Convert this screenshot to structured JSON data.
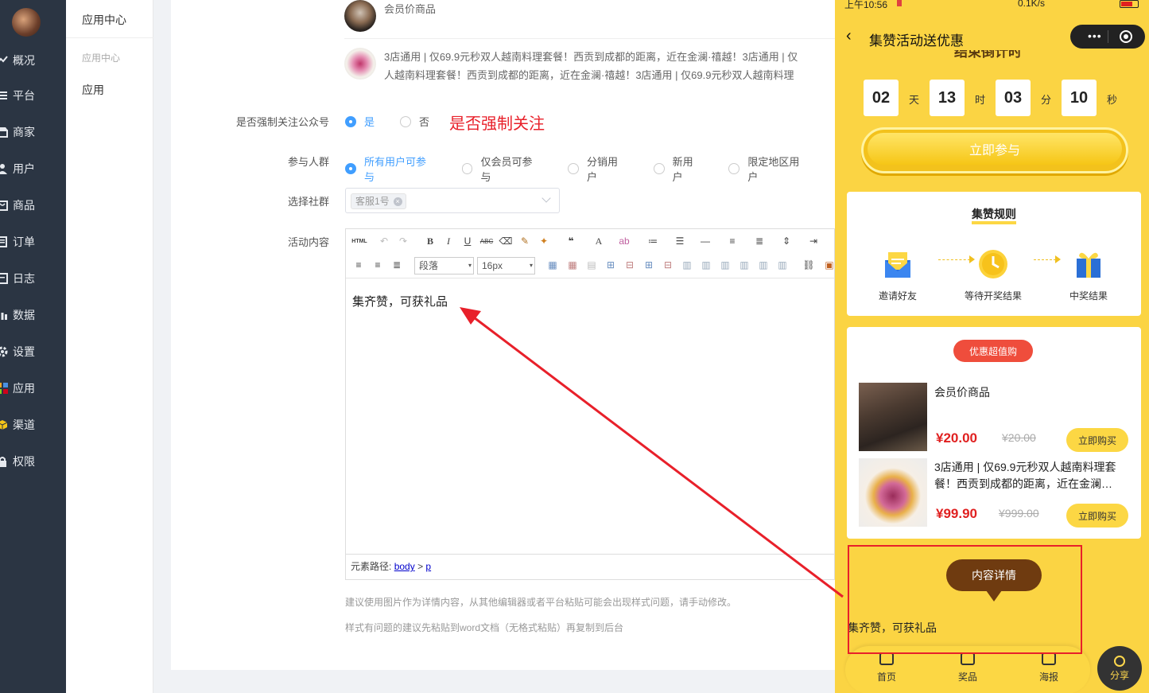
{
  "nav": {
    "items": [
      {
        "label": "概况",
        "icon": "chart-icon"
      },
      {
        "label": "平台",
        "icon": "list-icon"
      },
      {
        "label": "商家",
        "icon": "store-icon"
      },
      {
        "label": "用户",
        "icon": "user-icon"
      },
      {
        "label": "商品",
        "icon": "goods-icon"
      },
      {
        "label": "订单",
        "icon": "order-icon"
      },
      {
        "label": "日志",
        "icon": "log-icon"
      },
      {
        "label": "数据",
        "icon": "bar-chart-icon"
      },
      {
        "label": "设置",
        "icon": "gear-icon"
      },
      {
        "label": "应用",
        "icon": "apps-icon"
      },
      {
        "label": "渠道",
        "icon": "cube-icon"
      },
      {
        "label": "权限",
        "icon": "lock-icon"
      }
    ]
  },
  "submenu": {
    "title": "应用中心",
    "group": "应用中心",
    "item": "应用"
  },
  "products": [
    {
      "text": "会员价商品"
    },
    {
      "line1": "3店通用 | 仅69.9元秒双人越南料理套餐！西贡到成都的距离，近在金澜·禧越！3店通用 | 仅",
      "line2": "人越南料理套餐！西贡到成都的距离，近在金澜·禧越！3店通用 | 仅69.9元秒双人越南料理"
    }
  ],
  "form": {
    "follow_label": "是否强制关注公众号",
    "follow_yes": "是",
    "follow_no": "否",
    "follow_annotation": "是否强制关注",
    "crowd_label": "参与人群",
    "crowd_options": [
      "所有用户可参与",
      "仅会员可参与",
      "分销用户",
      "新用户",
      "限定地区用户"
    ],
    "community_label": "选择社群",
    "community_tag": "客服1号",
    "content_label": "活动内容"
  },
  "editor": {
    "paragraph": "段落",
    "fontsize": "16px",
    "content": "集齐赞，可获礼品",
    "path_label": "元素路径:",
    "path_body": "body",
    "path_sep": ">",
    "path_p": "p",
    "html_label": "HTML"
  },
  "hints": {
    "hint1": "建议使用图片作为详情内容，从其他编辑器或者平台粘贴可能会出现样式问题，请手动修改。",
    "hint2": "样式有问题的建议先粘贴到word文档（无格式粘贴）再复制到后台"
  },
  "phone": {
    "status_time": "上午10:56",
    "status_net": "0.1K/s",
    "title": "集赞活动送优惠",
    "countdown_title": "结束倒计时",
    "countdown": [
      {
        "v": "02",
        "u": "天"
      },
      {
        "v": "13",
        "u": "时"
      },
      {
        "v": "03",
        "u": "分"
      },
      {
        "v": "10",
        "u": "秒"
      }
    ],
    "join": "立即参与",
    "rules_title": "集赞规则",
    "steps": [
      "邀请好友",
      "等待开奖结果",
      "中奖结果"
    ],
    "promo_badge": "优惠超值购",
    "goods": [
      {
        "name": "会员价商品",
        "price": "¥20.00",
        "old": "¥20.00",
        "buy": "立即购买"
      },
      {
        "name": "3店通用 | 仅69.9元秒双人越南料理套餐！西贡到成都的距离，近在金澜…",
        "price": "¥99.90",
        "old": "¥999.00",
        "buy": "立即购买"
      }
    ],
    "detail_badge": "内容详情",
    "detail_text": "集齐赞，可获礼品",
    "tabs": [
      "首页",
      "奖品",
      "海报"
    ],
    "share": "分享"
  },
  "colors": {
    "accent": "#409eff",
    "annotation": "#e8202a",
    "phone_bg": "#fbd443",
    "nav_bg": "#2b3543"
  }
}
